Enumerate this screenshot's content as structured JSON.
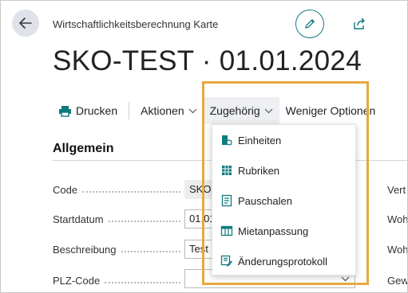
{
  "header": {
    "subtitle": "Wirtschaftlichkeitsberechnung Karte",
    "title": "SKO-TEST · 01.01.2024"
  },
  "actionbar": {
    "print_label": "Drucken",
    "actions_label": "Aktionen",
    "related_label": "Zugehörig",
    "fewer_label": "Weniger Optionen"
  },
  "section": {
    "title": "Allgemein"
  },
  "fields": [
    {
      "label": "Code",
      "value": "SKO-"
    },
    {
      "label": "Startdatum",
      "value": "01.01"
    },
    {
      "label": "Beschreibung",
      "value": "Test S"
    },
    {
      "label": "PLZ-Code",
      "value": ""
    }
  ],
  "right_labels": [
    "Vert",
    "Woh",
    "Woh",
    "Gew"
  ],
  "dropdown": {
    "items": [
      {
        "label": "Einheiten",
        "icon": "units-icon"
      },
      {
        "label": "Rubriken",
        "icon": "table-grid-icon"
      },
      {
        "label": "Pauschalen",
        "icon": "list-document-icon"
      },
      {
        "label": "Mietanpassung",
        "icon": "columns-icon"
      },
      {
        "label": "Änderungsprotokoll",
        "icon": "change-log-icon"
      }
    ]
  },
  "colors": {
    "accent": "#0f7b7f",
    "highlight": "#e8a83e"
  }
}
